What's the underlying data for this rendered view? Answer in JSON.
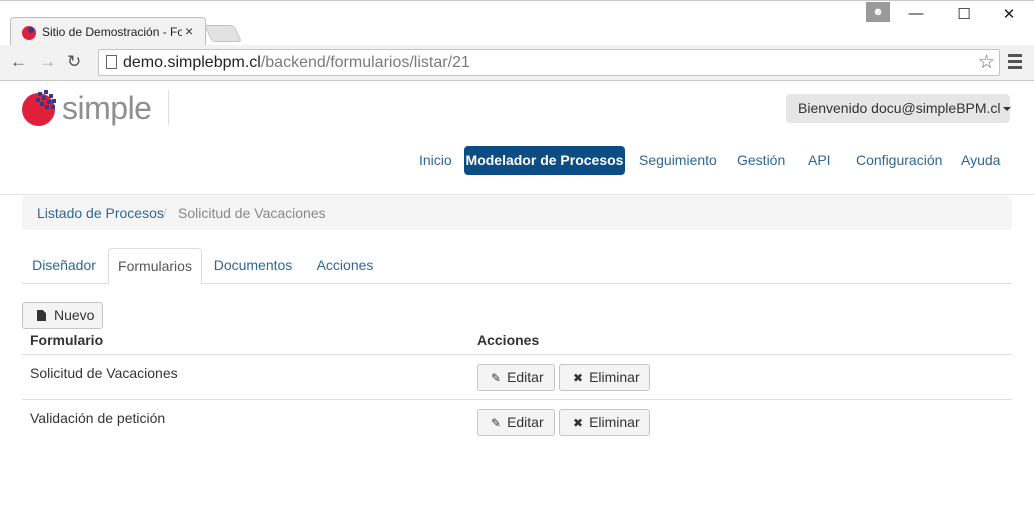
{
  "browser": {
    "tab_title": "Sitio de Demostración - Fo",
    "tab_close": "×",
    "url_host": "demo.simplebpm.cl",
    "url_path": "/backend/formularios/listar/21"
  },
  "header": {
    "logo_text": "simple",
    "user_greeting": "Bienvenido docu@simpleBPM.cl"
  },
  "nav": {
    "items": [
      {
        "label": "Inicio"
      },
      {
        "label": "Modelador de Procesos"
      },
      {
        "label": "Seguimiento"
      },
      {
        "label": "Gestión"
      },
      {
        "label": "API"
      },
      {
        "label": "Configuración"
      },
      {
        "label": "Ayuda"
      }
    ],
    "active_index": 1
  },
  "breadcrumb": {
    "link": "Listado de Procesos",
    "separator": "/",
    "current": "Solicitud de Vacaciones"
  },
  "tabs": [
    {
      "label": "Diseñador"
    },
    {
      "label": "Formularios"
    },
    {
      "label": "Documentos"
    },
    {
      "label": "Acciones"
    }
  ],
  "active_tab": 1,
  "toolbar": {
    "new_label": "Nuevo"
  },
  "table": {
    "headers": [
      "Formulario",
      "Acciones"
    ],
    "rows": [
      {
        "name": "Solicitud de Vacaciones",
        "edit_label": "Editar",
        "delete_label": "Eliminar"
      },
      {
        "name": "Validación de petición",
        "edit_label": "Editar",
        "delete_label": "Eliminar"
      }
    ]
  },
  "colors": {
    "primary": "#0d4d86",
    "link": "#2f6693",
    "logo_red": "#e0203a",
    "logo_blue": "#2a3d8f"
  }
}
